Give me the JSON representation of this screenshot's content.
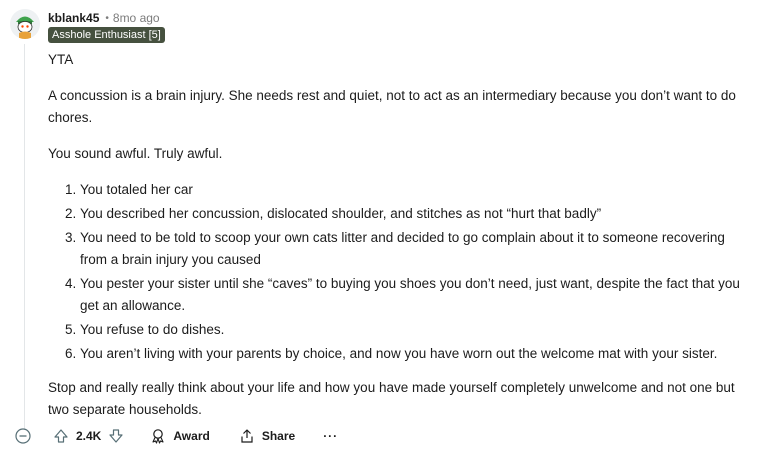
{
  "comment": {
    "author": "kblank45",
    "separator": "•",
    "time": "8mo ago",
    "flair": "Asshole Enthusiast [5]",
    "paragraphs_top": [
      "YTA",
      "A concussion is a brain injury. She needs rest and quiet, not to act as an intermediary because you don’t want to do chores.",
      "You sound awful. Truly awful."
    ],
    "list": [
      "You totaled her car",
      "You described her concussion, dislocated shoulder, and stitches as not “hurt that badly”",
      "You need to be told to scoop your own cats litter and decided to go complain about it to someone recovering from a brain injury you caused",
      "You pester your sister until she “caves” to buying you shoes you don’t need, just want, despite the fact that you get an allowance.",
      "You refuse to do dishes.",
      "You aren’t living with your parents by choice, and now you have worn out the welcome mat with your sister."
    ],
    "paragraph_bottom": "Stop and really really think about your life and how you have made yourself completely unwelcome and not one but two separate households."
  },
  "actions": {
    "score": "2.4K",
    "award_label": "Award",
    "share_label": "Share",
    "more_label": "···"
  },
  "icons": {
    "collapse": "minus-circle-icon",
    "upvote": "arrow-up-icon",
    "downvote": "arrow-down-icon",
    "award": "award-icon",
    "share": "share-icon"
  }
}
